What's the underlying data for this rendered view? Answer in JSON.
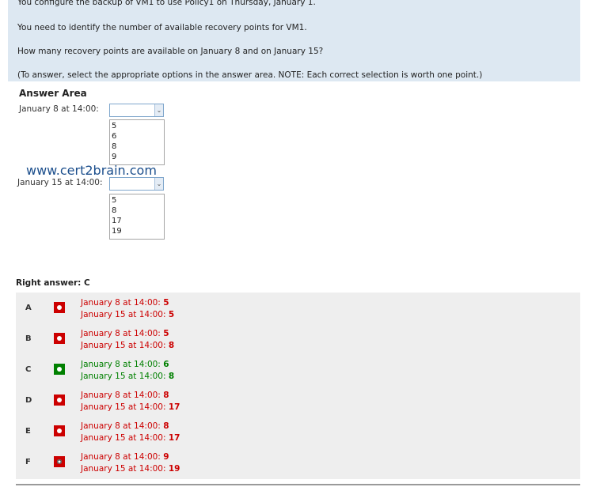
{
  "question": {
    "lines": [
      "You configure the backup of VM1 to use Policy1 on Thursday, January 1.",
      "You need to identify the number of available recovery points for VM1.",
      "How many recovery points are available on January 8 and on January 15?",
      "(To answer, select the appropriate options in the answer area. NOTE: Each correct selection is worth one point.)"
    ]
  },
  "answer_area": {
    "title": "Answer Area",
    "fields": [
      {
        "label": "January 8 at 14:00:",
        "options": [
          "5",
          "6",
          "8",
          "9"
        ]
      },
      {
        "label": "January 15 at 14:00:",
        "options": [
          "5",
          "8",
          "17",
          "19"
        ]
      }
    ]
  },
  "watermark": "www.cert2brain.com",
  "right_answer": "Right answer: C",
  "colors": {
    "correct": "#008000",
    "incorrect": "#cc0000",
    "question_bg": "#dde8f2",
    "panel_bg": "#eeeeee"
  },
  "choices": [
    {
      "letter": "A",
      "line1_label": "January 8 at 14:00: ",
      "line1_value": "5",
      "line2_label": "January 15 at 14:00: ",
      "line2_value": "5",
      "correct": false,
      "icon": "incorrect-marker-icon"
    },
    {
      "letter": "B",
      "line1_label": "January 8 at 14:00: ",
      "line1_value": "5",
      "line2_label": "January 15 at 14:00: ",
      "line2_value": "8",
      "correct": false,
      "icon": "incorrect-marker-icon"
    },
    {
      "letter": "C",
      "line1_label": "January 8 at 14:00: ",
      "line1_value": "6",
      "line2_label": "January 15 at 14:00: ",
      "line2_value": "8",
      "correct": true,
      "icon": "correct-marker-icon"
    },
    {
      "letter": "D",
      "line1_label": "January 8 at 14:00: ",
      "line1_value": "8",
      "line2_label": "January 15 at 14:00: ",
      "line2_value": "17",
      "correct": false,
      "icon": "incorrect-marker-icon"
    },
    {
      "letter": "E",
      "line1_label": "January 8 at 14:00: ",
      "line1_value": "8",
      "line2_label": "January 15 at 14:00: ",
      "line2_value": "17",
      "correct": false,
      "icon": "incorrect-marker-icon"
    },
    {
      "letter": "F",
      "line1_label": "January 8 at 14:00: ",
      "line1_value": "9",
      "line2_label": "January 15 at 14:00: ",
      "line2_value": "19",
      "correct": false,
      "icon": "incorrect-marker-icon"
    }
  ]
}
